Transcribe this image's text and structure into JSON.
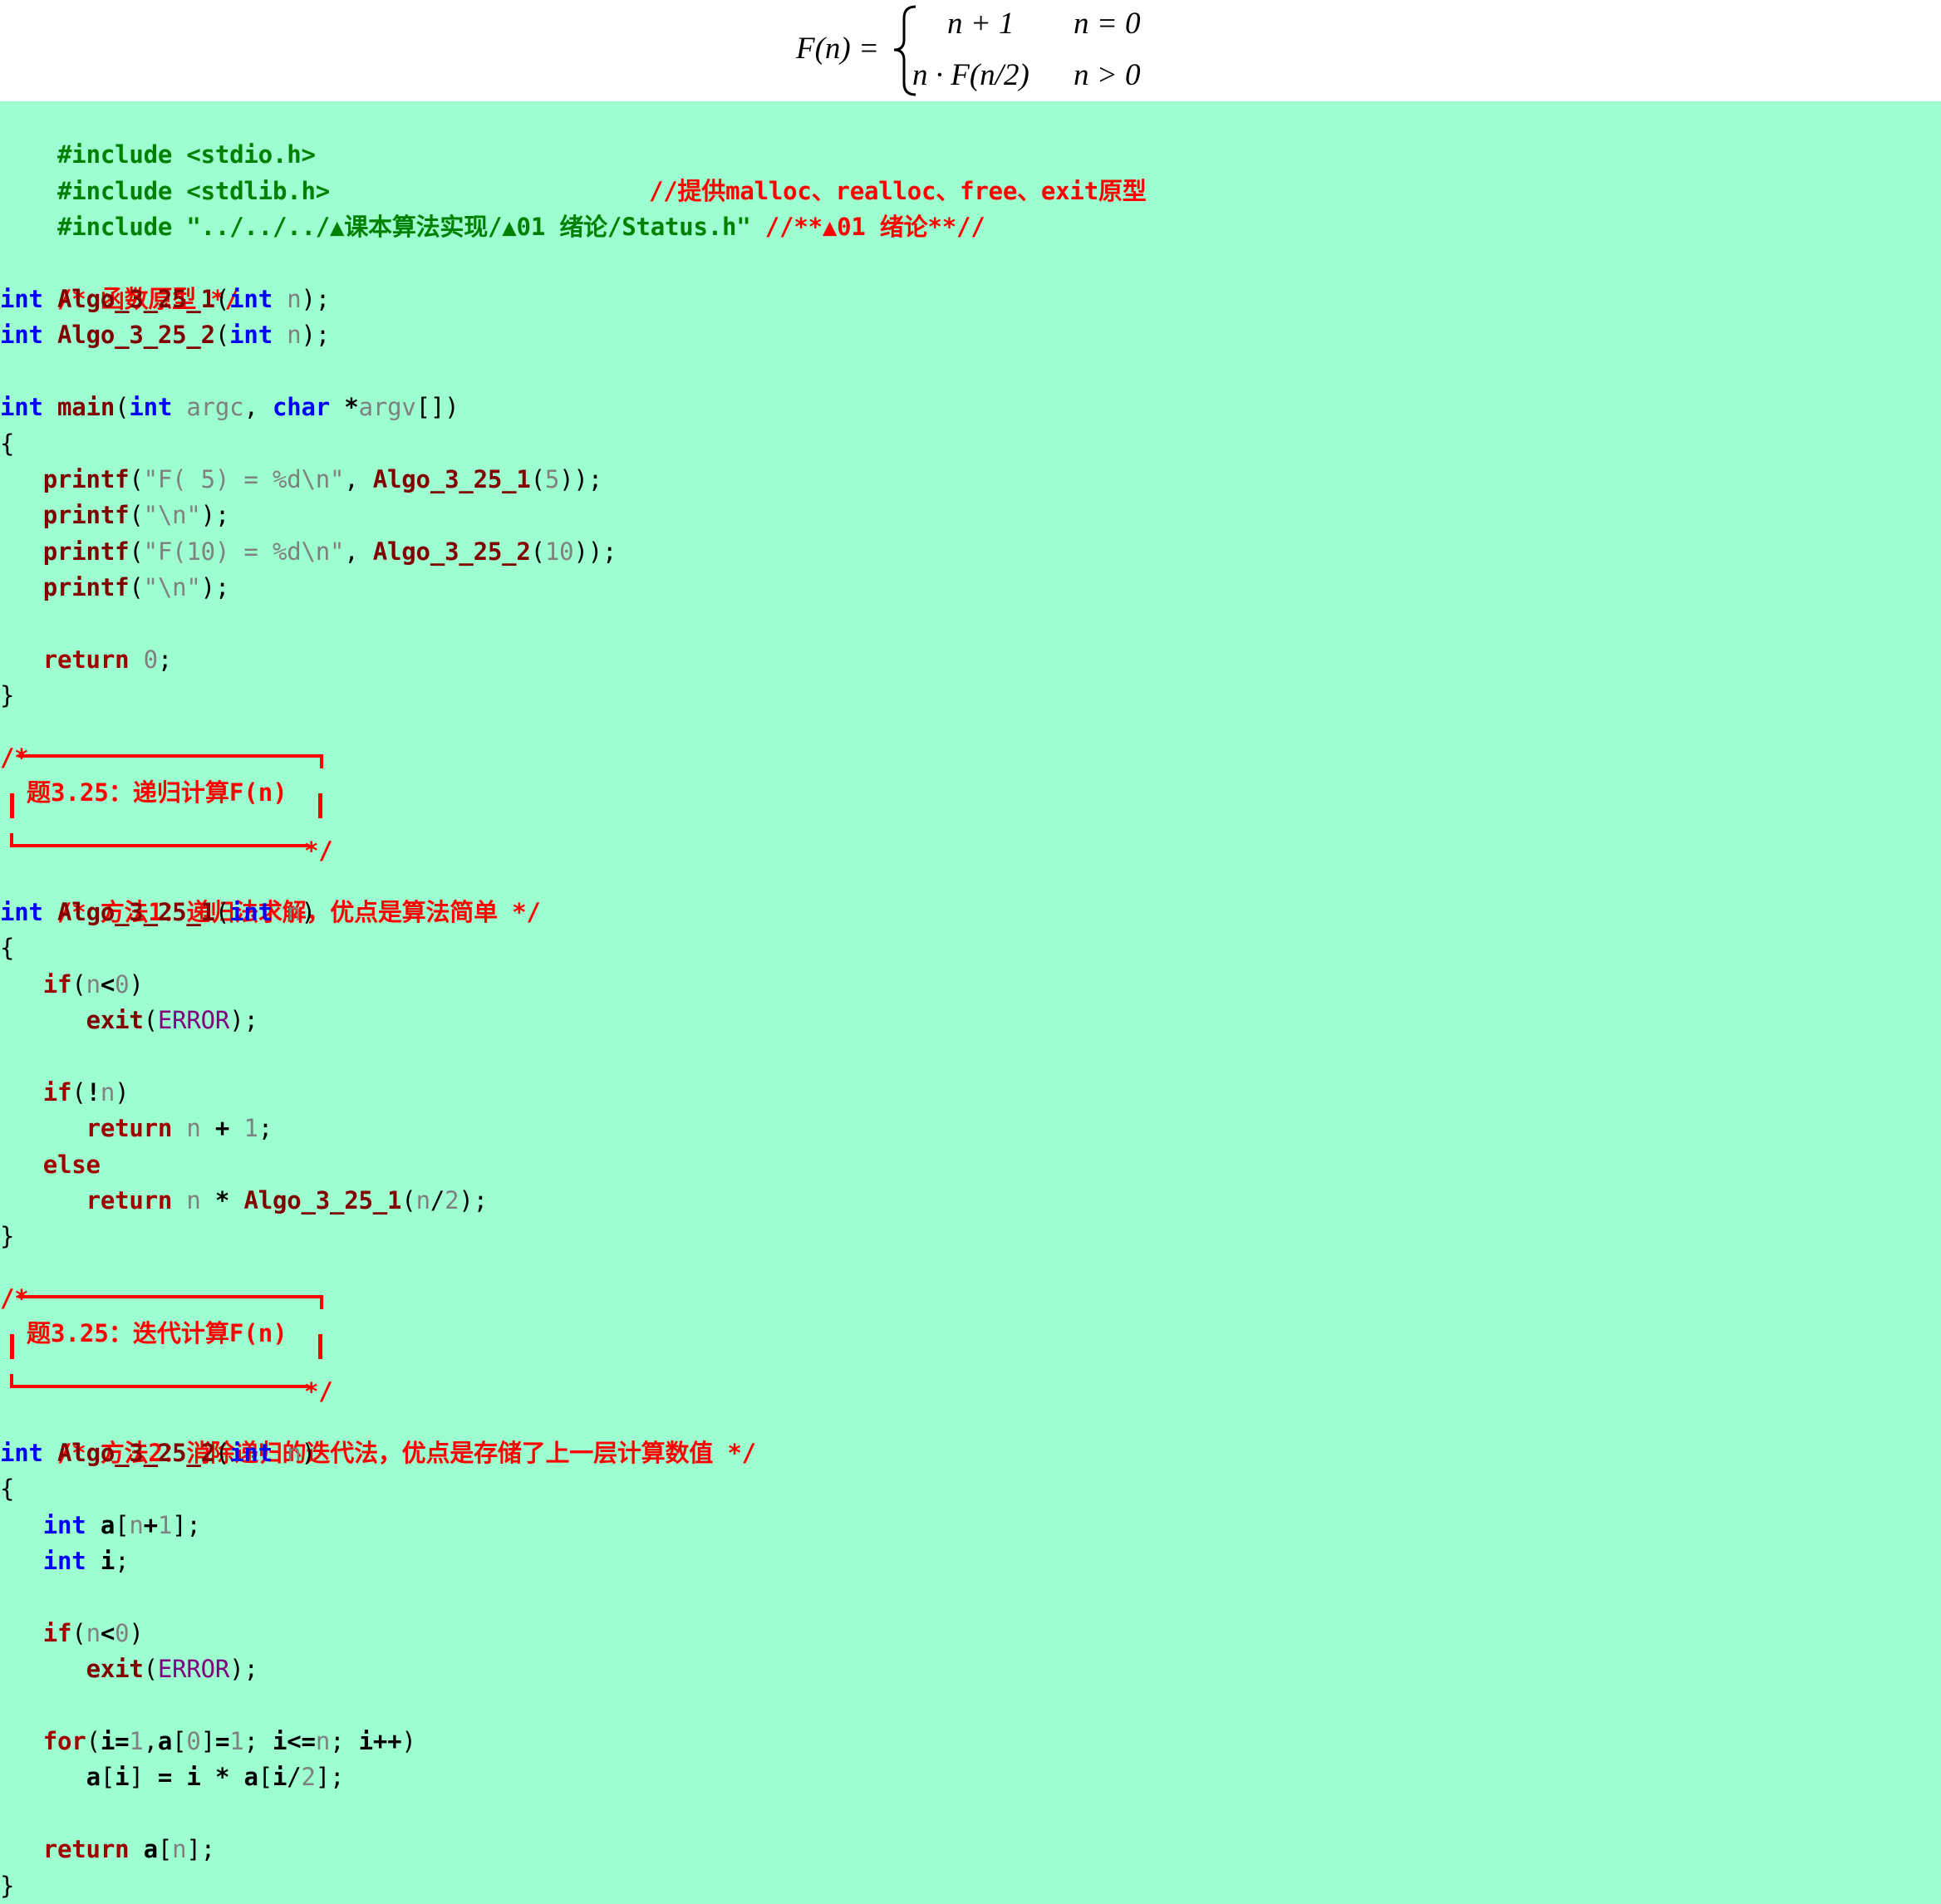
{
  "formula": {
    "lhs": "F(n) =",
    "case1_expr": "n + 1",
    "case1_cond": "n = 0",
    "case2_expr": "n · F(n/2)",
    "case2_cond": "n > 0"
  },
  "colors": {
    "background": "#9dffcf",
    "preprocessor": "#008000",
    "comment": "#ff0000",
    "keyword": "#0000ff",
    "control": "#a00000",
    "function": "#800000",
    "parameter": "#808080",
    "macro": "#800080"
  },
  "code": {
    "include1": {
      "directive": "#include <stdio.h>"
    },
    "include2": {
      "directive": "#include <stdlib.h>",
      "comment": "//提供malloc、realloc、free、exit原型"
    },
    "include3": {
      "directive": "#include \"../../../▲课本算法实现/▲01 绪论/Status.h\"",
      "comment": "//**▲01 绪论**//"
    },
    "proto_comment": "/* 函数原型 */",
    "proto1": {
      "type": "int",
      "name": "Algo_3_25_1",
      "ptype": "int",
      "pname": "n"
    },
    "proto2": {
      "type": "int",
      "name": "Algo_3_25_2",
      "ptype": "int",
      "pname": "n"
    },
    "main": {
      "type": "int",
      "name": "main",
      "p1type": "int",
      "p1name": "argc",
      "p2type": "char",
      "p2name": "argv",
      "print1": {
        "fn": "printf",
        "fmt": "\"F( 5) = %d\\n\"",
        "call": "Algo_3_25_1",
        "arg": "5"
      },
      "print2": {
        "fn": "printf",
        "fmt": "\"\\n\""
      },
      "print3": {
        "fn": "printf",
        "fmt": "\"F(10) = %d\\n\"",
        "call": "Algo_3_25_2",
        "arg": "10"
      },
      "print4": {
        "fn": "printf",
        "fmt": "\"\\n\""
      },
      "ret": "return",
      "ret_val": "0"
    },
    "banner1": {
      "open": "/*",
      "title": "题3.25：递归计算F(n)",
      "close": "*/"
    },
    "method1_comment": "/* 方法1：递归法求解，优点是算法简单 */",
    "algo1": {
      "type": "int",
      "name": "Algo_3_25_1",
      "ptype": "int",
      "pname": "n",
      "if_kw": "if",
      "n": "n",
      "zero": "0",
      "exit": "exit",
      "error": "ERROR",
      "return_kw": "return",
      "one": "1",
      "else_kw": "else",
      "two": "2"
    },
    "banner2": {
      "open": "/*",
      "title": "题3.25：迭代计算F(n)",
      "close": "*/"
    },
    "method2_comment": "/* 方法2：消除递归的迭代法，优点是存储了上一层计算数值 */",
    "algo2": {
      "type": "int",
      "name": "Algo_3_25_2",
      "ptype": "int",
      "pname": "n",
      "arr": "a",
      "idx": "i",
      "for_kw": "for"
    }
  }
}
